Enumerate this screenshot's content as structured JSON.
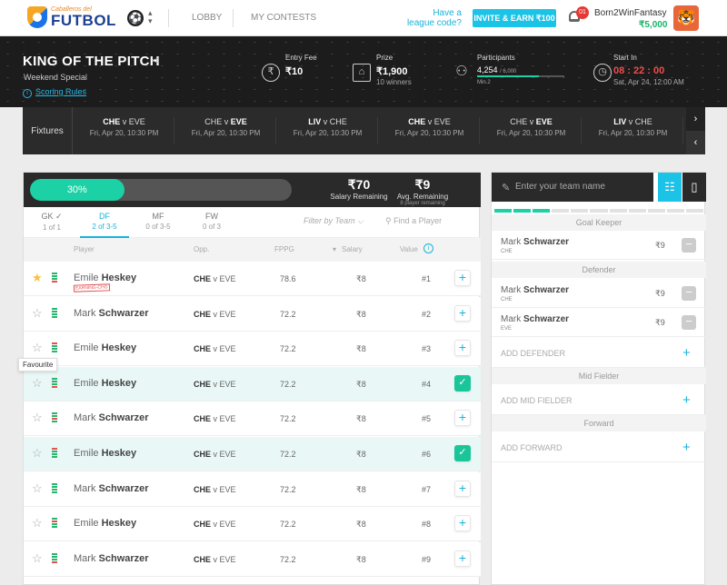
{
  "header": {
    "logo_small": "Caballeros del",
    "logo_big": "FUTBOL",
    "nav_lobby": "LOBBY",
    "nav_contests": "MY CONTESTS",
    "league_q1": "Have a",
    "league_q2": "league code?",
    "invite": "INVITE & EARN ₹100",
    "notif_count": "01",
    "username": "Born2WinFantasy",
    "balance": "₹5,000"
  },
  "contest": {
    "title": "KING OF THE PITCH",
    "subtitle": "Weekend Special",
    "rules": "Scoring Rules",
    "entry_label": "Entry Fee",
    "entry_value": "₹10",
    "prize_label": "Prize",
    "prize_value": "₹1,900",
    "prize_sub": "10 winners",
    "participants_label": "Participants",
    "participants_value": "4,254",
    "participants_max": "/ 6,000",
    "participants_min": "Min.2",
    "participants_fill": 0.71,
    "start_label": "Start In",
    "start_time": "08 : 22 : 00",
    "start_date": "Sat, Apr 24, 12:00 AM"
  },
  "fixtures": {
    "label": "Fixtures",
    "items": [
      {
        "a": "CHE",
        "v": " v ",
        "b": "EVE",
        "bold": "a",
        "date": "Fri, Apr 20, 10:30 PM"
      },
      {
        "a": "CHE",
        "v": " v ",
        "b": "EVE",
        "bold": "b",
        "date": "Fri, Apr 20, 10:30 PM"
      },
      {
        "a": "LIV",
        "v": " v ",
        "b": "CHE",
        "bold": "a",
        "date": "Fri, Apr 20, 10:30 PM"
      },
      {
        "a": "CHE",
        "v": " v ",
        "b": "EVE",
        "bold": "a",
        "date": "Fri, Apr 20, 10:30 PM"
      },
      {
        "a": "CHE",
        "v": " v ",
        "b": "EVE",
        "bold": "b",
        "date": "Fri, Apr 20, 10:30 PM"
      },
      {
        "a": "LIV",
        "v": " v ",
        "b": "CHE",
        "bold": "a",
        "date": "Fri, Apr 20, 10:30 PM"
      }
    ]
  },
  "pool": {
    "progress_label": "30%",
    "progress": 0.36,
    "salary_value": "₹70",
    "salary_label": "Salary Remaining",
    "avg_value": "₹9",
    "avg_label": "Avg. Remaining",
    "avg_sub": "8 player remaining",
    "tabs": [
      {
        "label": "GK ✓",
        "count": "1 of 1"
      },
      {
        "label": "DF",
        "count": "2 of 3-5"
      },
      {
        "label": "MF",
        "count": "0 of 3-5"
      },
      {
        "label": "FW",
        "count": "0 of 3"
      }
    ],
    "filter": "Filter by Team",
    "find": "Find a Player",
    "cols": {
      "player": "Player",
      "opp": "Opp.",
      "fppg": "FPPG",
      "salary": "Salary",
      "value": "Value"
    },
    "rows": [
      {
        "first": "Emile",
        "last": "Heskey",
        "team": "CHE",
        "vs": " v EVE",
        "fppg": "78.6",
        "salary": "₹8",
        "rank": "#1",
        "star": true,
        "injury": "EARNING-CHG",
        "selected": false
      },
      {
        "first": "Mark",
        "last": "Schwarzer",
        "team": "CHE",
        "vs": " v EVE",
        "fppg": "72.2",
        "salary": "₹8",
        "rank": "#2",
        "star": false,
        "selected": false
      },
      {
        "first": "Emile",
        "last": "Heskey",
        "team": "CHE",
        "vs": " v EVE",
        "fppg": "72.2",
        "salary": "₹8",
        "rank": "#3",
        "star": false,
        "selected": false
      },
      {
        "first": "Emile",
        "last": "Heskey",
        "team": "CHE",
        "vs": " v EVE",
        "fppg": "72.2",
        "salary": "₹8",
        "rank": "#4",
        "star": false,
        "selected": true
      },
      {
        "first": "Mark",
        "last": "Schwarzer",
        "team": "CHE",
        "vs": " v EVE",
        "fppg": "72.2",
        "salary": "₹8",
        "rank": "#5",
        "star": false,
        "selected": false
      },
      {
        "first": "Emile",
        "last": "Heskey",
        "team": "CHE",
        "vs": " v EVE",
        "fppg": "72.2",
        "salary": "₹8",
        "rank": "#6",
        "star": false,
        "selected": true
      },
      {
        "first": "Mark",
        "last": "Schwarzer",
        "team": "CHE",
        "vs": " v EVE",
        "fppg": "72.2",
        "salary": "₹8",
        "rank": "#7",
        "star": false,
        "selected": false
      },
      {
        "first": "Emile",
        "last": "Heskey",
        "team": "CHE",
        "vs": " v EVE",
        "fppg": "72.2",
        "salary": "₹8",
        "rank": "#8",
        "star": false,
        "selected": false
      },
      {
        "first": "Mark",
        "last": "Schwarzer",
        "team": "CHE",
        "vs": " v EVE",
        "fppg": "72.2",
        "salary": "₹8",
        "rank": "#9",
        "star": false,
        "selected": false
      }
    ],
    "tooltip": "Favourite"
  },
  "team": {
    "placeholder": "Enter your team name",
    "segments_filled": 3,
    "segments_total": 11,
    "gk_label": "Goal Keeper",
    "df_label": "Defender",
    "mf_label": "Mid Fielder",
    "fw_label": "Forward",
    "gk": [
      {
        "first": "Mark",
        "last": "Schwarzer",
        "team": "CHE",
        "salary": "₹9"
      }
    ],
    "df": [
      {
        "first": "Mark",
        "last": "Schwarzer",
        "team": "CHE",
        "salary": "₹9"
      },
      {
        "first": "Mark",
        "last": "Schwarzer",
        "team": "EVE",
        "salary": "₹9"
      }
    ],
    "add_df": "ADD DEFENDER",
    "add_mf": "ADD MID FIELDER",
    "add_fw": "ADD FORWARD"
  }
}
